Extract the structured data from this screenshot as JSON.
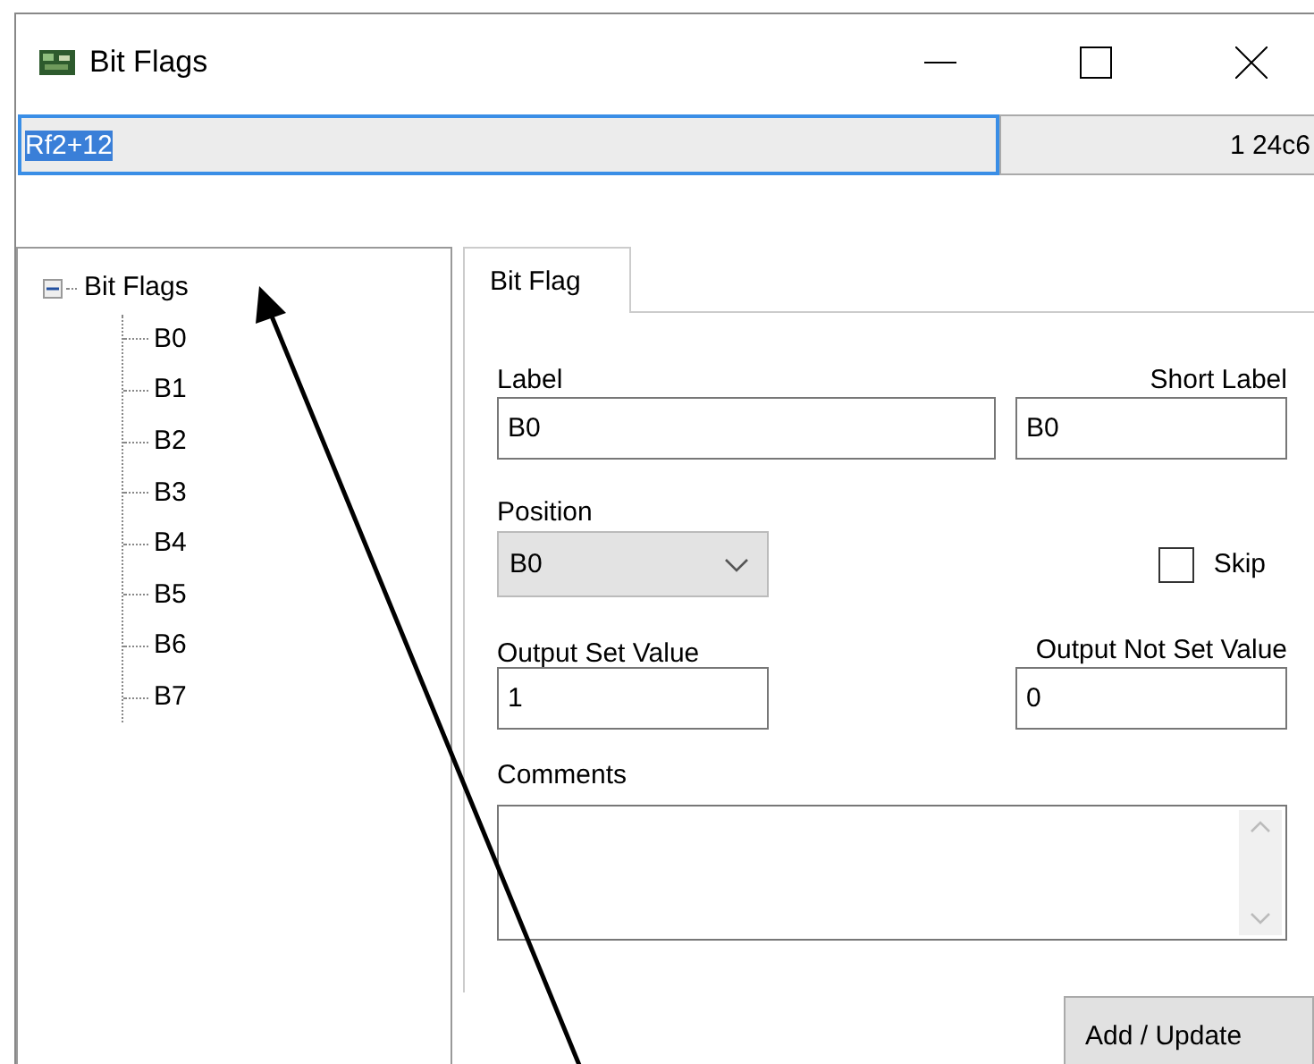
{
  "window": {
    "title": "Bit Flags"
  },
  "address_bar": {
    "expression": "Rf2+12",
    "expression_selected": true,
    "value": "1 24c6"
  },
  "tree": {
    "label": "Bit Flags",
    "expanded": true,
    "children": [
      {
        "label": "B0"
      },
      {
        "label": "B1"
      },
      {
        "label": "B2"
      },
      {
        "label": "B3"
      },
      {
        "label": "B4"
      },
      {
        "label": "B5"
      },
      {
        "label": "B6"
      },
      {
        "label": "B7"
      }
    ]
  },
  "tabs": [
    {
      "label": "Bit Flag",
      "selected": true
    }
  ],
  "form": {
    "label": {
      "caption": "Label",
      "value": "B0"
    },
    "short_label": {
      "caption": "Short Label",
      "value": "B0"
    },
    "position": {
      "caption": "Position",
      "value": "B0"
    },
    "skip": {
      "caption": "Skip",
      "checked": false
    },
    "output_set_value": {
      "caption": "Output Set Value",
      "value": "1"
    },
    "output_not_set_value": {
      "caption": "Output Not Set Value",
      "value": "0"
    },
    "comments": {
      "caption": "Comments"
    }
  },
  "buttons": [
    "Add / Update"
  ]
}
